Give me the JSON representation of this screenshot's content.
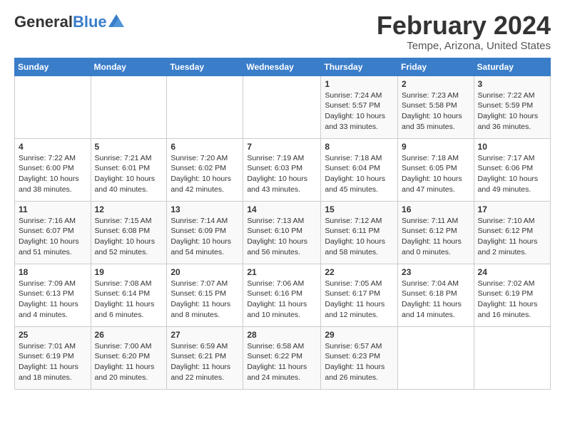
{
  "header": {
    "logo_text_general": "General",
    "logo_text_blue": "Blue",
    "month_title": "February 2024",
    "location": "Tempe, Arizona, United States"
  },
  "calendar": {
    "days_of_week": [
      "Sunday",
      "Monday",
      "Tuesday",
      "Wednesday",
      "Thursday",
      "Friday",
      "Saturday"
    ],
    "weeks": [
      [
        {
          "day": "",
          "info": ""
        },
        {
          "day": "",
          "info": ""
        },
        {
          "day": "",
          "info": ""
        },
        {
          "day": "",
          "info": ""
        },
        {
          "day": "1",
          "info": "Sunrise: 7:24 AM\nSunset: 5:57 PM\nDaylight: 10 hours\nand 33 minutes."
        },
        {
          "day": "2",
          "info": "Sunrise: 7:23 AM\nSunset: 5:58 PM\nDaylight: 10 hours\nand 35 minutes."
        },
        {
          "day": "3",
          "info": "Sunrise: 7:22 AM\nSunset: 5:59 PM\nDaylight: 10 hours\nand 36 minutes."
        }
      ],
      [
        {
          "day": "4",
          "info": "Sunrise: 7:22 AM\nSunset: 6:00 PM\nDaylight: 10 hours\nand 38 minutes."
        },
        {
          "day": "5",
          "info": "Sunrise: 7:21 AM\nSunset: 6:01 PM\nDaylight: 10 hours\nand 40 minutes."
        },
        {
          "day": "6",
          "info": "Sunrise: 7:20 AM\nSunset: 6:02 PM\nDaylight: 10 hours\nand 42 minutes."
        },
        {
          "day": "7",
          "info": "Sunrise: 7:19 AM\nSunset: 6:03 PM\nDaylight: 10 hours\nand 43 minutes."
        },
        {
          "day": "8",
          "info": "Sunrise: 7:18 AM\nSunset: 6:04 PM\nDaylight: 10 hours\nand 45 minutes."
        },
        {
          "day": "9",
          "info": "Sunrise: 7:18 AM\nSunset: 6:05 PM\nDaylight: 10 hours\nand 47 minutes."
        },
        {
          "day": "10",
          "info": "Sunrise: 7:17 AM\nSunset: 6:06 PM\nDaylight: 10 hours\nand 49 minutes."
        }
      ],
      [
        {
          "day": "11",
          "info": "Sunrise: 7:16 AM\nSunset: 6:07 PM\nDaylight: 10 hours\nand 51 minutes."
        },
        {
          "day": "12",
          "info": "Sunrise: 7:15 AM\nSunset: 6:08 PM\nDaylight: 10 hours\nand 52 minutes."
        },
        {
          "day": "13",
          "info": "Sunrise: 7:14 AM\nSunset: 6:09 PM\nDaylight: 10 hours\nand 54 minutes."
        },
        {
          "day": "14",
          "info": "Sunrise: 7:13 AM\nSunset: 6:10 PM\nDaylight: 10 hours\nand 56 minutes."
        },
        {
          "day": "15",
          "info": "Sunrise: 7:12 AM\nSunset: 6:11 PM\nDaylight: 10 hours\nand 58 minutes."
        },
        {
          "day": "16",
          "info": "Sunrise: 7:11 AM\nSunset: 6:12 PM\nDaylight: 11 hours\nand 0 minutes."
        },
        {
          "day": "17",
          "info": "Sunrise: 7:10 AM\nSunset: 6:12 PM\nDaylight: 11 hours\nand 2 minutes."
        }
      ],
      [
        {
          "day": "18",
          "info": "Sunrise: 7:09 AM\nSunset: 6:13 PM\nDaylight: 11 hours\nand 4 minutes."
        },
        {
          "day": "19",
          "info": "Sunrise: 7:08 AM\nSunset: 6:14 PM\nDaylight: 11 hours\nand 6 minutes."
        },
        {
          "day": "20",
          "info": "Sunrise: 7:07 AM\nSunset: 6:15 PM\nDaylight: 11 hours\nand 8 minutes."
        },
        {
          "day": "21",
          "info": "Sunrise: 7:06 AM\nSunset: 6:16 PM\nDaylight: 11 hours\nand 10 minutes."
        },
        {
          "day": "22",
          "info": "Sunrise: 7:05 AM\nSunset: 6:17 PM\nDaylight: 11 hours\nand 12 minutes."
        },
        {
          "day": "23",
          "info": "Sunrise: 7:04 AM\nSunset: 6:18 PM\nDaylight: 11 hours\nand 14 minutes."
        },
        {
          "day": "24",
          "info": "Sunrise: 7:02 AM\nSunset: 6:19 PM\nDaylight: 11 hours\nand 16 minutes."
        }
      ],
      [
        {
          "day": "25",
          "info": "Sunrise: 7:01 AM\nSunset: 6:19 PM\nDaylight: 11 hours\nand 18 minutes."
        },
        {
          "day": "26",
          "info": "Sunrise: 7:00 AM\nSunset: 6:20 PM\nDaylight: 11 hours\nand 20 minutes."
        },
        {
          "day": "27",
          "info": "Sunrise: 6:59 AM\nSunset: 6:21 PM\nDaylight: 11 hours\nand 22 minutes."
        },
        {
          "day": "28",
          "info": "Sunrise: 6:58 AM\nSunset: 6:22 PM\nDaylight: 11 hours\nand 24 minutes."
        },
        {
          "day": "29",
          "info": "Sunrise: 6:57 AM\nSunset: 6:23 PM\nDaylight: 11 hours\nand 26 minutes."
        },
        {
          "day": "",
          "info": ""
        },
        {
          "day": "",
          "info": ""
        }
      ]
    ]
  }
}
